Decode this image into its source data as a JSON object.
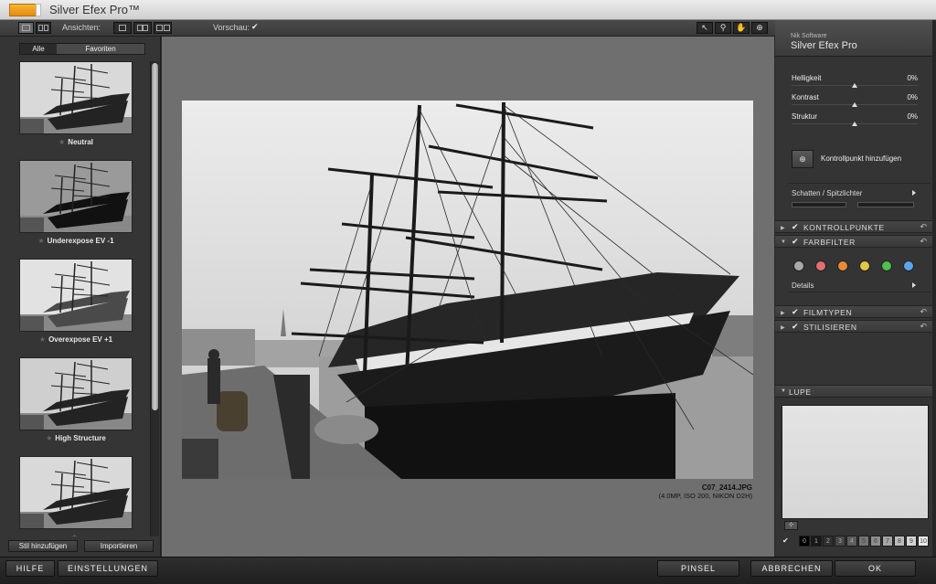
{
  "window": {
    "title": "Silver Efex Pro™"
  },
  "toolbar": {
    "views_label": "Ansichten:",
    "preview_label": "Vorschau:",
    "preview_checked": true,
    "tools": [
      "pointer-tool",
      "zoom-tool",
      "hand-tool",
      "control-point-tool"
    ]
  },
  "left_panel": {
    "filter_tabs": {
      "all": "Alle",
      "favorites": "Favoriten"
    },
    "presets": [
      {
        "label": "Neutral",
        "favorite": false
      },
      {
        "label": "Underexpose EV -1",
        "favorite": false
      },
      {
        "label": "Overexpose EV +1",
        "favorite": false
      },
      {
        "label": "High Structure",
        "favorite": false
      },
      {
        "label": "",
        "favorite": false
      }
    ],
    "add_style_button": "Stil hinzufügen",
    "import_button": "Importieren"
  },
  "preview": {
    "file_name": "C07_2414.JPG",
    "file_info": "(4.0MP, ISO 200, NIKON D2H)"
  },
  "right_panel": {
    "company": "Nik Software",
    "product": "Silver Efex Pro",
    "sliders": [
      {
        "name": "Helligkeit",
        "value": "0%",
        "position": 0.5
      },
      {
        "name": "Kontrast",
        "value": "0%",
        "position": 0.5
      },
      {
        "name": "Struktur",
        "value": "0%",
        "position": 0.5
      }
    ],
    "control_point_label": "Kontrollpunkt hinzufügen",
    "shadows_highlights_label": "Schatten / Spitzlichter",
    "sections": {
      "control_points": "KONTROLLPUNKTE",
      "color_filter": "FARBFILTER",
      "film_types": "FILMTYPEN",
      "stylize": "STILISIEREN"
    },
    "color_filters": [
      "#a9a9a9",
      "#e07070",
      "#e88a3a",
      "#e3c745",
      "#4fbf4f",
      "#5aa6e8"
    ],
    "details_label": "Details",
    "loupe_label": "LUPE",
    "zones": [
      "0",
      "1",
      "2",
      "3",
      "4",
      "5",
      "6",
      "7",
      "8",
      "9",
      "10"
    ]
  },
  "bottom_bar": {
    "help": "HILFE",
    "settings": "EINSTELLUNGEN",
    "brush": "PINSEL",
    "cancel": "ABBRECHEN",
    "ok": "OK"
  }
}
